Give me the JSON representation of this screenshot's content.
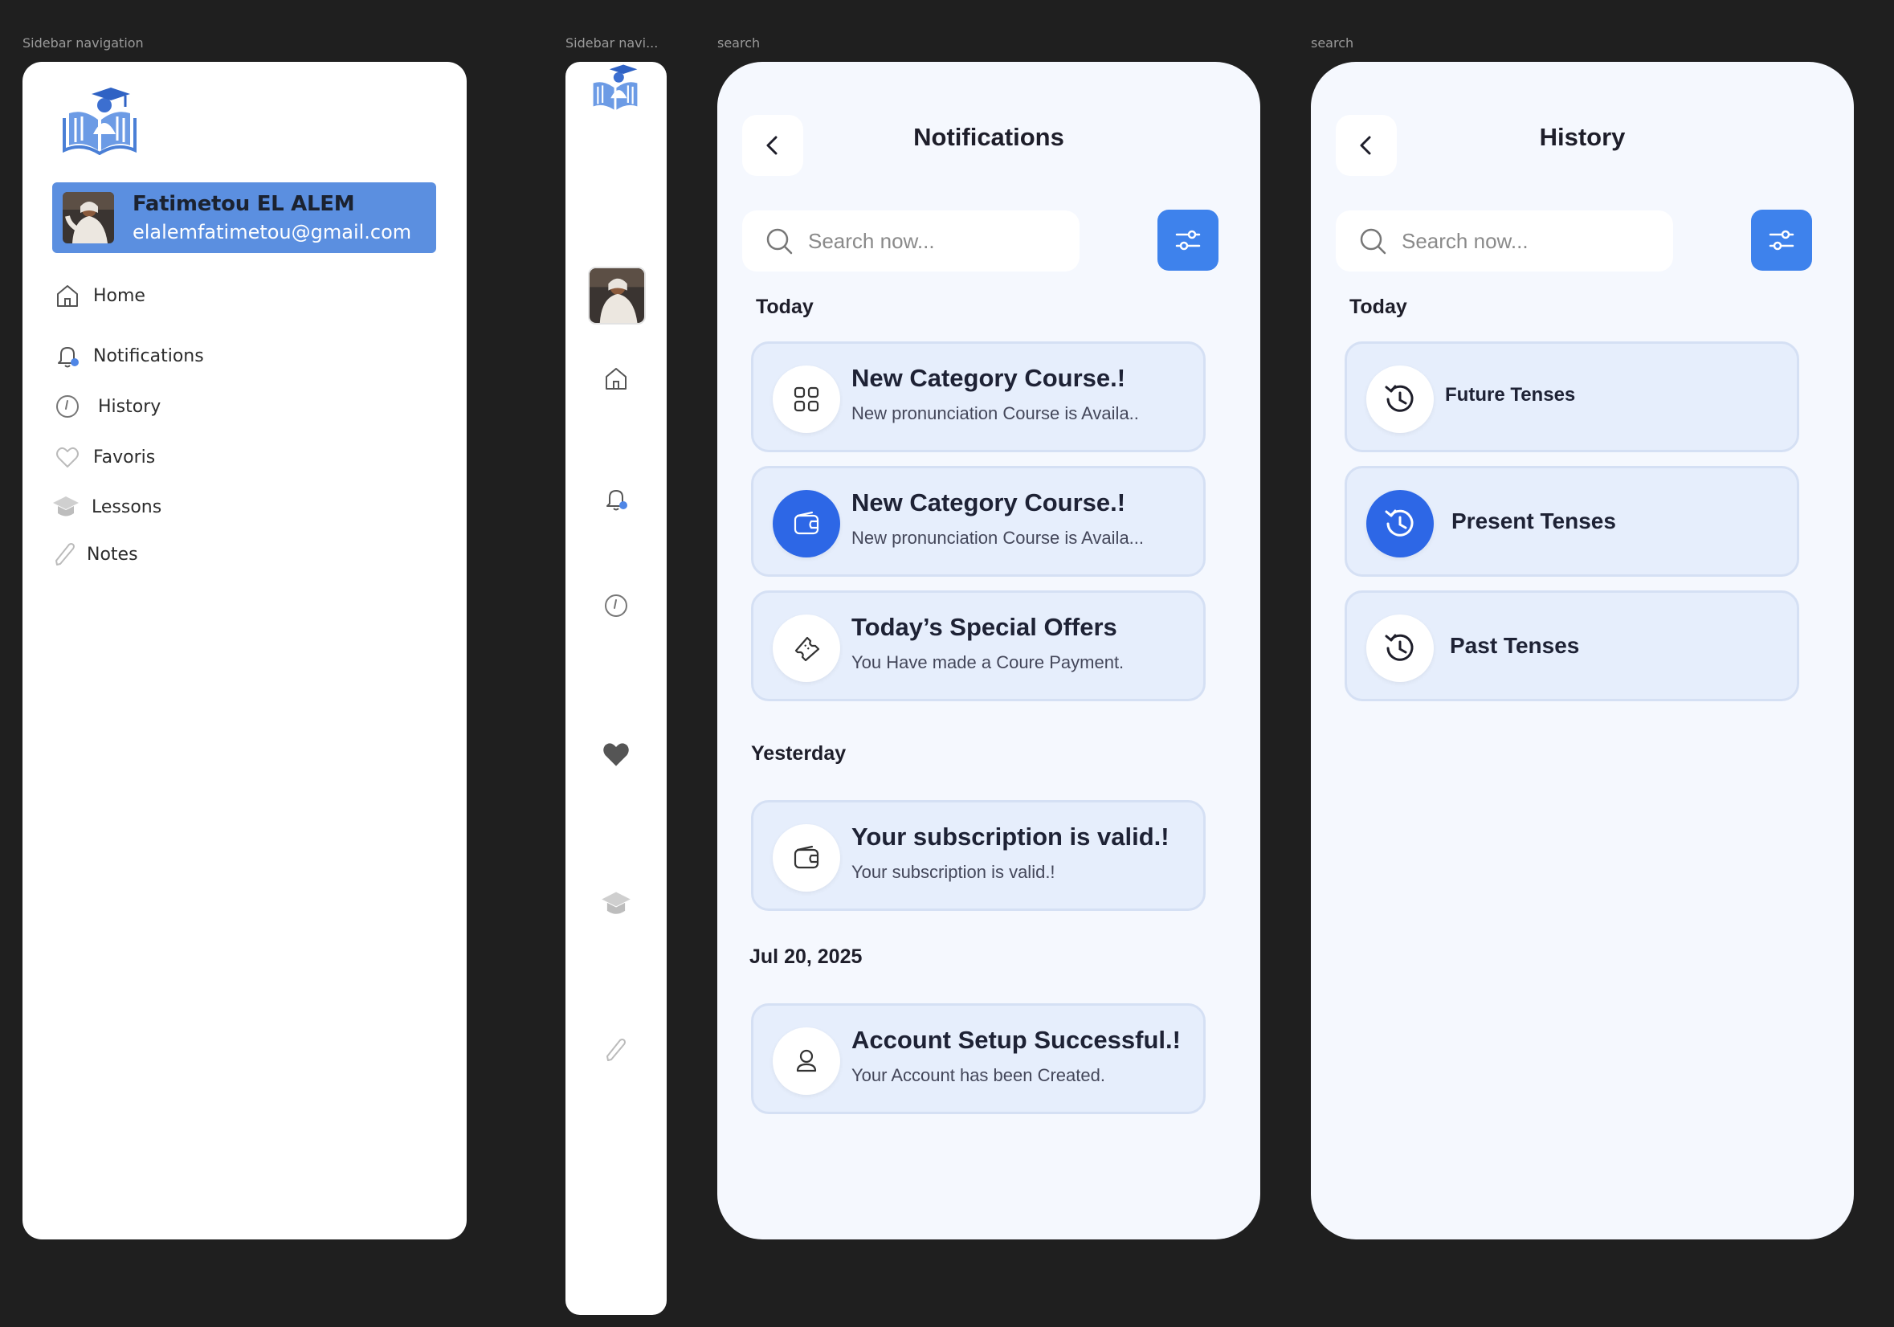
{
  "labels": {
    "sidebar_expanded": "Sidebar navigation",
    "sidebar_collapsed": "Sidebar navi...",
    "notifications_screen": "search",
    "history_screen": "search"
  },
  "profile": {
    "name": "Fatimetou EL ALEM",
    "email": "elalemfatimetou@gmail.com"
  },
  "nav": {
    "home": "Home",
    "notifications": "Notifications",
    "history": "History",
    "favoris": "Favoris",
    "lessons": "Lessons",
    "notes": "Notes"
  },
  "colors": {
    "accent": "#3e82ec",
    "profile_card": "#5b8fe0",
    "card_bg": "#e6eefc",
    "active_icon": "#2d67e6"
  },
  "notifications": {
    "title": "Notifications",
    "search_placeholder": "Search now...",
    "sections": [
      {
        "label": "Today",
        "items": [
          {
            "title": "New Category Course.!",
            "subtitle": "New pronunciation Course is Availa..",
            "icon": "grid-icon"
          },
          {
            "title": "New Category Course.!",
            "subtitle": "New pronunciation Course is Availa...",
            "icon": "wallet-icon"
          },
          {
            "title": "Today’s Special Offers",
            "subtitle": "You Have made a Coure Payment.",
            "icon": "ticket-icon"
          }
        ]
      },
      {
        "label": "Yesterday",
        "items": [
          {
            "title": "Your subscription is valid.!",
            "subtitle": "Your subscription is valid.!",
            "icon": "wallet-icon"
          }
        ]
      },
      {
        "label": "Jul 20, 2025",
        "items": [
          {
            "title": "Account Setup Successful.!",
            "subtitle": "Your Account has been Created.",
            "icon": "user-icon"
          }
        ]
      }
    ]
  },
  "history": {
    "title": "History",
    "search_placeholder": "Search now...",
    "section": "Today",
    "items": [
      {
        "title": "Future Tenses",
        "icon": "history-icon"
      },
      {
        "title": "Present Tenses",
        "icon": "history-icon"
      },
      {
        "title": "Past Tenses",
        "icon": "history-icon"
      }
    ]
  }
}
